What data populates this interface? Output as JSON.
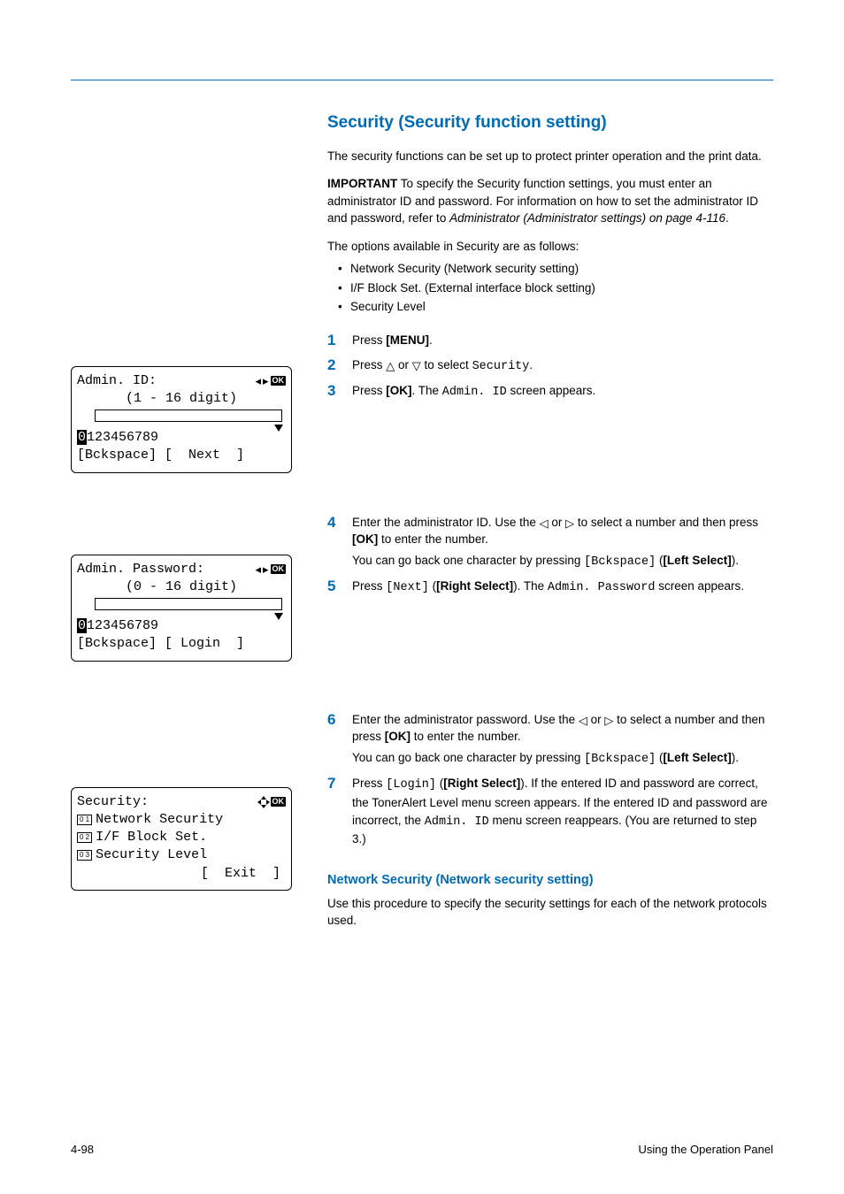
{
  "header_rule": true,
  "section": {
    "title": "Security (Security function setting)",
    "intro": "The security functions can be set up to protect printer operation and the print data.",
    "important_label": "IMPORTANT",
    "important_body_1": "  To specify the Security function settings, you must enter an administrator ID and password. For information on how to set the administrator ID and password, refer to ",
    "important_ref": "Administrator (Administrator settings) on page 4-116",
    "important_dot": ".",
    "options_intro": "The options available in Security are as follows:",
    "options": [
      "Network Security (Network security setting)",
      "I/F Block Set. (External interface block setting)",
      "Security Level"
    ]
  },
  "steps": {
    "s1_a": "Press ",
    "s1_b": "[MENU]",
    "s1_c": ".",
    "s2_a": "Press ",
    "s2_b": " or ",
    "s2_c": " to select ",
    "s2_d": "Security",
    "s2_e": ".",
    "s3_a": "Press ",
    "s3_b": "[OK]",
    "s3_c": ". The ",
    "s3_d": "Admin. ID",
    "s3_e": " screen  appears.",
    "s4_a": "Enter the administrator ID. Use the ",
    "s4_b": " or ",
    "s4_c": " to select a number and then press ",
    "s4_d": "[OK]",
    "s4_e": " to enter the number.",
    "s4_sub_a": "You can go back one character by pressing ",
    "s4_sub_b": "[Bckspace]",
    "s4_sub_c": " (",
    "s4_sub_d": "[Left Select]",
    "s4_sub_e": ").",
    "s5_a": "Press ",
    "s5_b": "[Next]",
    "s5_c": " (",
    "s5_d": "[Right Select]",
    "s5_e": "). The ",
    "s5_f": "Admin. Password",
    "s5_g": " screen appears.",
    "s6_a": "Enter the administrator password. Use the ",
    "s6_b": " or ",
    "s6_c": " to select a number and then press ",
    "s6_d": "[OK]",
    "s6_e": " to enter the number.",
    "s6_sub_a": "You can go back one character by pressing ",
    "s6_sub_b": "[Bckspace]",
    "s6_sub_c": " (",
    "s6_sub_d": "[Left Select]",
    "s6_sub_e": ").",
    "s7_a": "Press ",
    "s7_b": "[Login]",
    "s7_c": " (",
    "s7_d": "[Right Select]",
    "s7_e": "). If the entered ID and password are correct, the TonerAlert Level menu screen appears. If the entered ID and password are incorrect, the ",
    "s7_f": "Admin. ID",
    "s7_g": " menu screen reappears. (You are returned to step 3.)"
  },
  "panels": {
    "admin_id": {
      "title": "Admin. ID:",
      "range": "(1 - 16 digit)",
      "digits_first": "0",
      "digits_rest": "123456789",
      "left_soft": "[Bckspace]",
      "right_soft": "[  Next  ]"
    },
    "admin_pw": {
      "title": "Admin. Password:",
      "range": "(0 - 16 digit)",
      "digits_first": "0",
      "digits_rest": "123456789",
      "left_soft": "[Bckspace]",
      "right_soft": "[ Login  ]"
    },
    "security_menu": {
      "title": "Security:",
      "item1_num": "0 1",
      "item1": "Network Security",
      "item2_num": "0 2",
      "item2": "I/F Block Set.",
      "item3_num": "0 3",
      "item3": "Security Level",
      "right_soft": "[  Exit  ]"
    }
  },
  "subsection": {
    "title": "Network Security (Network security setting)",
    "body": "Use this procedure to specify the security settings for each of the network protocols used."
  },
  "footer": {
    "left": "4-98",
    "right": "Using the Operation Panel"
  }
}
